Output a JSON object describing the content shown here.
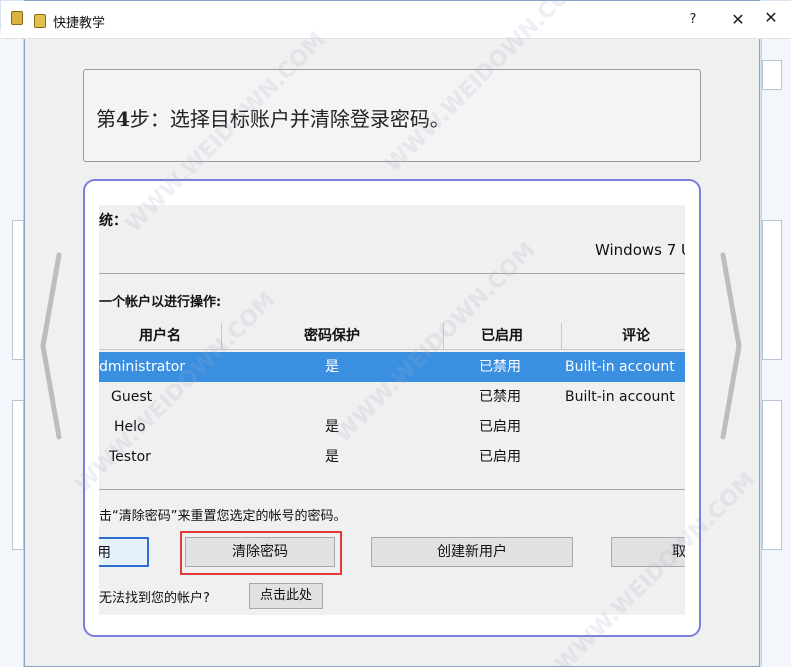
{
  "titlebar": {
    "title": "快捷教学",
    "help_label": "?",
    "close_label": "✕",
    "bg_close_label": "✕"
  },
  "step": {
    "text_prefix": "第",
    "step_number": "4",
    "text_suffix": "步：选择目标账户并清除登录密码。"
  },
  "screenshot": {
    "os_label": "统：",
    "os_value": "Windows 7 U",
    "select_label": "一个帐户以进行操作:",
    "table": {
      "headers": [
        "用户名",
        "密码保护",
        "已启用",
        "评论"
      ],
      "rows": [
        {
          "user": "dministrator",
          "protected": "是",
          "enabled": "已禁用",
          "comment": "Built-in account"
        },
        {
          "user": "Guest",
          "protected": "",
          "enabled": "已禁用",
          "comment": "Built-in account"
        },
        {
          "user": "Helo",
          "protected": "是",
          "enabled": "已启用",
          "comment": ""
        },
        {
          "user": "Testor",
          "protected": "是",
          "enabled": "已启用",
          "comment": ""
        }
      ]
    },
    "hint": "击“清除密码”来重置您选定的帐号的密码。",
    "buttons": {
      "apply_label": "用",
      "clear_password_label": "清除密码",
      "create_user_label": "创建新用户",
      "cancel_label": "取消"
    },
    "cant_find_label": "无法找到您的帐户?",
    "click_here_label": "点击此处"
  },
  "watermark_text": "WWW.WEIDOWN.COM",
  "colors": {
    "selection": "#3a8fe0",
    "highlight_box": "#e23a3a",
    "frame_border": "#7b7fdc"
  }
}
